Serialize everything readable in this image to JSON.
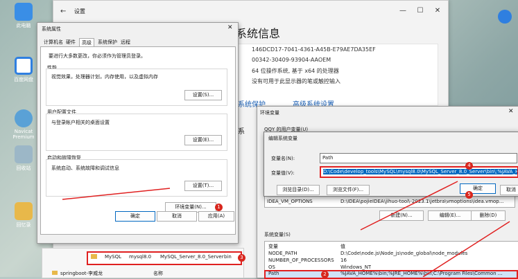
{
  "desktop": {
    "icons": [
      {
        "label": "此电脑",
        "color": "#3a8ee6"
      },
      {
        "label": "百度网盘",
        "color": "#2f7fe0"
      },
      {
        "label": "Navicat Premium",
        "color": "#5aa1d6"
      },
      {
        "label": "回收站",
        "color": "#9cb7c7"
      },
      {
        "label": "回忆录",
        "color": "#e8b84a"
      }
    ]
  },
  "settings": {
    "title": "设置",
    "heading": "系统信息",
    "info": [
      "146DCD17-7041-4361-A45B-E79AE7DA35EF",
      "00342-30409-93904-AAOEM",
      "64 位操作系统, 基于 x64 的处理器",
      "没有可用于此显示器的笔或触控输入"
    ],
    "links": [
      "系统保护",
      "高级系统设置"
    ],
    "side_text": "系"
  },
  "sysprops": {
    "title": "系统属性",
    "tabs": [
      "计算机名",
      "硬件",
      "高级",
      "系统保护",
      "远程"
    ],
    "admin_note": "要进行大多数更改，你必须作为管理员登录。",
    "groups": [
      {
        "title": "性能",
        "desc": "视觉效果，处理器计划，内存使用，以及虚拟内存",
        "button": "设置(S)..."
      },
      {
        "title": "用户配置文件",
        "desc": "与登录帐户相关的桌面设置",
        "button": "设置(E)..."
      },
      {
        "title": "启动和故障恢复",
        "desc": "系统启动、系统故障和调试信息",
        "button": "设置(T)..."
      }
    ],
    "env_button": "环境变量(N)...",
    "ok": "确定",
    "cancel": "取消",
    "apply": "应用(A)"
  },
  "envvars": {
    "title": "环境变量",
    "user_section": "QQY 的用户变量(U)",
    "user_row": {
      "name": "IDEA_VM_OPTIONS",
      "value": "D:\\IDEA\\pojieIDEA\\jihuo-tool\\-2023.1\\jetbra\\vmoptions\\idea.vmop..."
    },
    "user_buttons": [
      "新建(N)...",
      "编辑(E)...",
      "删除(D)"
    ],
    "sys_section": "系统变量(S)",
    "col_var": "变量",
    "col_val": "值",
    "sys_rows": [
      {
        "name": "NODE_PATH",
        "value": "D:\\Code\\node.js\\Node_js\\node_global\\node_modules"
      },
      {
        "name": "NUMBER_OF_PROCESSORS",
        "value": "16"
      },
      {
        "name": "OS",
        "value": "Windows_NT"
      },
      {
        "name": "Path",
        "value": "%JAVA_HOME%\\bin;%JRE_HOME%\\bin;C:\\Program Files\\Common ..."
      }
    ]
  },
  "edit": {
    "title": "编辑系统变量",
    "name_label": "变量名(N):",
    "name_value": "Path",
    "value_label": "变量值(V):",
    "value_value": "D:\\Code\\develop_tools\\MySQL\\mysql8.0\\MySQL_Server_8.0_Server\\bin\\;%JAVA_HOME",
    "browse_dir": "浏览目录(D)...",
    "browse_file": "浏览文件(F)...",
    "ok": "确定",
    "cancel": "取消"
  },
  "explorer": {
    "breadcrumb": [
      "MySQL",
      "mysql8.0",
      "MySQL_Server_8.0_Server",
      "bin"
    ],
    "folder": "springboot-李威龙",
    "col_name": "名称"
  },
  "badges": [
    "1",
    "2",
    "3",
    "4",
    "5"
  ],
  "colors": {
    "accent": "#0067c0",
    "annotation": "#e02020"
  }
}
